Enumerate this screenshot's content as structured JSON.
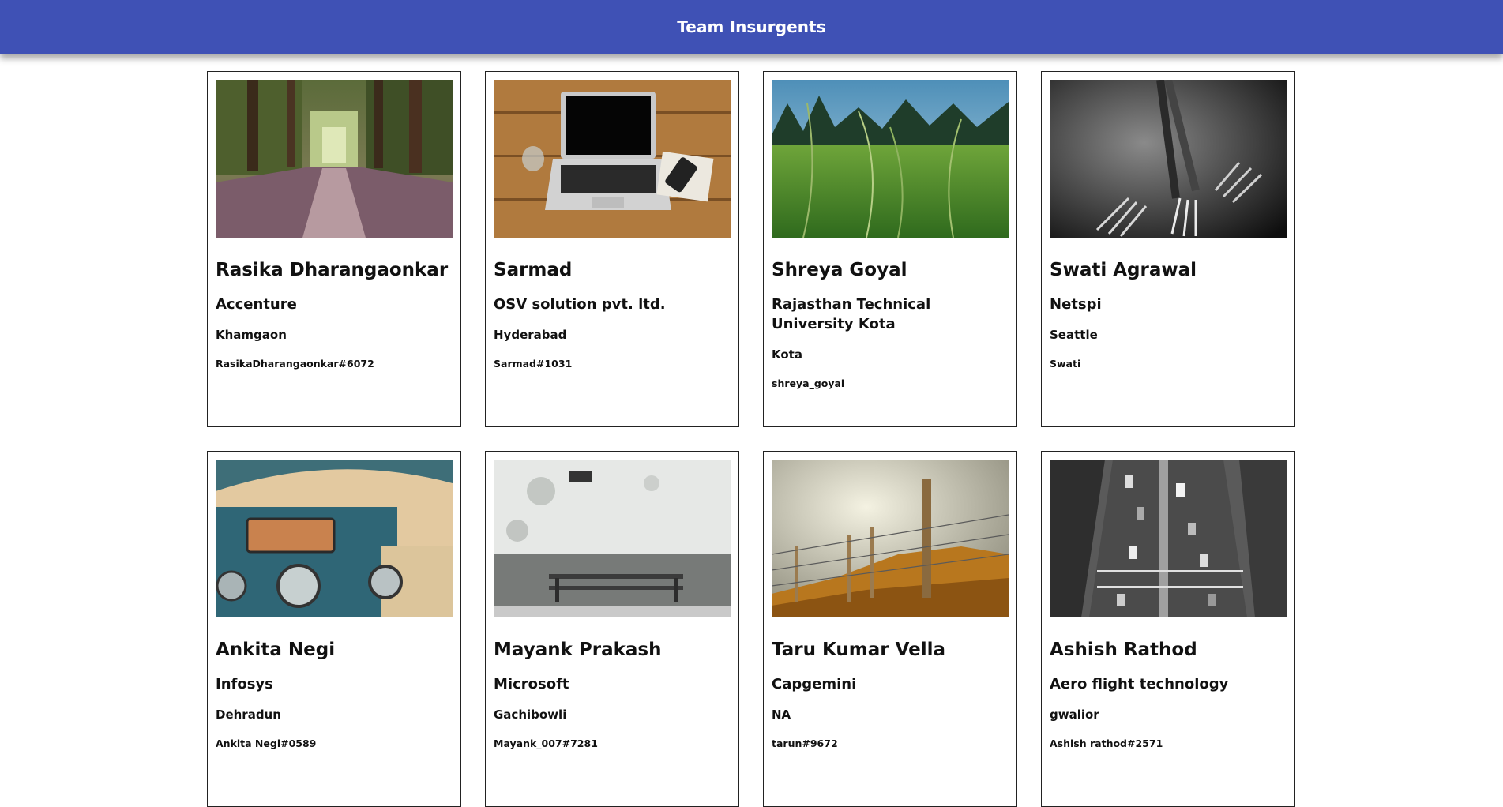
{
  "header": {
    "title": "Team Insurgents"
  },
  "members": [
    {
      "name": "Rasika Dharangaonkar",
      "company": "Accenture",
      "city": "Khamgaon",
      "handle": "RasikaDharangaonkar#6072",
      "photo": "forest-path-photo"
    },
    {
      "name": "Sarmad",
      "company": "OSV solution pvt. ltd.",
      "city": "Hyderabad",
      "handle": "Sarmad#1031",
      "photo": "laptop-desk-photo"
    },
    {
      "name": "Shreya Goyal",
      "company": "Rajasthan Technical University Kota",
      "city": "Kota",
      "handle": "shreya_goyal",
      "photo": "grass-field-photo"
    },
    {
      "name": "Swati Agrawal",
      "company": "Netspi",
      "city": "Seattle",
      "handle": "Swati",
      "photo": "forks-photo"
    },
    {
      "name": "Ankita Negi",
      "company": "Infosys",
      "city": "Dehradun",
      "handle": "Ankita Negi#0589",
      "photo": "tuktuk-photo"
    },
    {
      "name": "Mayank Prakash",
      "company": "Microsoft",
      "city": "Gachibowli",
      "handle": "Mayank_007#7281",
      "photo": "bench-wall-photo"
    },
    {
      "name": "Taru Kumar Vella",
      "company": "Capgemini",
      "city": "NA",
      "handle": "tarun#9672",
      "photo": "fence-photo"
    },
    {
      "name": "Ashish Rathod",
      "company": "Aero flight technology",
      "city": "gwalior",
      "handle": "Ashish rathod#2571",
      "photo": "traffic-road-photo"
    }
  ]
}
